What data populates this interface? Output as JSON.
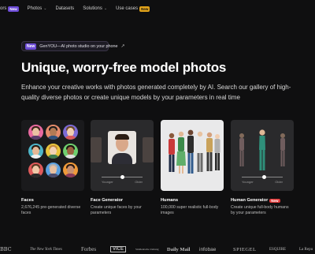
{
  "nav": {
    "items": [
      {
        "label": "ors",
        "badge": "New",
        "badge_color": "#6c4bd6"
      },
      {
        "label": "Photos",
        "chevron": true
      },
      {
        "label": "Datasets"
      },
      {
        "label": "Solutions",
        "chevron": true
      },
      {
        "label": "Use cases",
        "badge": "New",
        "badge_color": "#e0a21a"
      }
    ]
  },
  "promo": {
    "badge": "New",
    "text": "GenYOU—AI photo studio on your phone",
    "arrow_icon": "arrow-right-icon"
  },
  "hero": {
    "title": "Unique, worry-free model photos",
    "subtitle": "Enhance your creative works with photos generated completely by AI. Search our gallery of high-quality diverse photos or create unique models by your parameters in real time"
  },
  "cards": [
    {
      "title": "Faces",
      "description": "2,676,245 pre-generated diverse faces"
    },
    {
      "title": "Face Generator",
      "description": "Create unique faces by your parameters",
      "slider": {
        "left": "Younger",
        "right": "Older",
        "value": 0.5
      }
    },
    {
      "title": "Humans",
      "description": "100,000 super realistic full-body images"
    },
    {
      "title": "Human Generator",
      "badge": "New",
      "description": "Create unique full-body humans by your parameters",
      "slider": {
        "left": "Younger",
        "right": "Older",
        "value": 0.55
      }
    }
  ],
  "logos": [
    "BBC",
    "The New York Times",
    "Forbes",
    "VICE",
    "Süddeutsche Zeitung",
    "Daily Mail",
    "infobae",
    "SPIEGEL",
    "ESQUIRE",
    "La Repu"
  ],
  "colors": {
    "background": "#0f0f10",
    "accent_purple": "#6c4bd6",
    "new_red": "#e23a3a"
  }
}
